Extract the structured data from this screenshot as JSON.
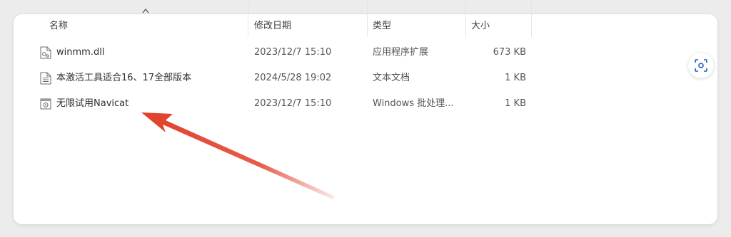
{
  "columns": {
    "name": "名称",
    "date": "修改日期",
    "type": "类型",
    "size": "大小"
  },
  "files": [
    {
      "name": "winmm.dll",
      "date": "2023/12/7 15:10",
      "type": "应用程序扩展",
      "size": "673 KB",
      "icon": "dll-file-icon"
    },
    {
      "name": "本激活工具适合16、17全部版本",
      "date": "2024/5/28 19:02",
      "type": "文本文档",
      "size": "1 KB",
      "icon": "text-document-icon"
    },
    {
      "name": "无限试用Navicat",
      "date": "2023/12/7 15:10",
      "type": "Windows 批处理...",
      "size": "1 KB",
      "icon": "batch-file-icon"
    }
  ],
  "colors": {
    "arrow": "#e2402b",
    "accent": "#1a5fb4"
  }
}
